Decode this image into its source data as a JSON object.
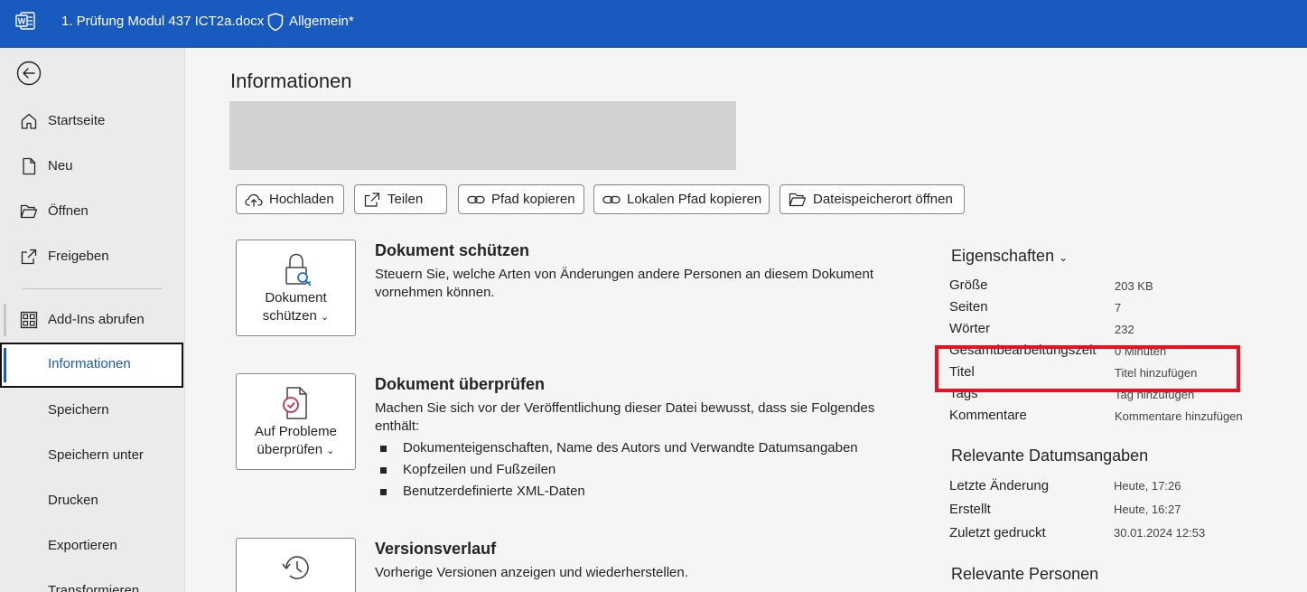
{
  "titlebar": {
    "doc_title": "1. Prüfung Modul 437 ICT2a.docx",
    "sensitivity": "Allgemein*",
    "accent": "#185abd"
  },
  "sidebar": {
    "items": [
      {
        "label": "Startseite",
        "icon": "home-icon"
      },
      {
        "label": "Neu",
        "icon": "new-document-icon"
      },
      {
        "label": "Öffnen",
        "icon": "folder-open-icon"
      },
      {
        "label": "Freigeben",
        "icon": "share-icon"
      },
      {
        "label": "Add-Ins abrufen",
        "icon": "apps-grid-icon"
      },
      {
        "label": "Informationen",
        "active": true
      },
      {
        "label": "Speichern"
      },
      {
        "label": "Speichern unter"
      },
      {
        "label": "Drucken"
      },
      {
        "label": "Exportieren"
      },
      {
        "label": "Transformieren"
      }
    ]
  },
  "main": {
    "heading": "Informationen",
    "actions": [
      {
        "label": "Hochladen",
        "icon": "upload-cloud-icon"
      },
      {
        "label": "Teilen",
        "icon": "share-icon"
      },
      {
        "label": "Pfad kopieren",
        "icon": "link-icon"
      },
      {
        "label": "Lokalen Pfad kopieren",
        "icon": "link-icon"
      },
      {
        "label": "Dateispeicherort öffnen",
        "icon": "folder-icon"
      }
    ],
    "protect": {
      "button_line1": "Dokument",
      "button_line2": "schützen",
      "title": "Dokument schützen",
      "text": "Steuern Sie, welche Arten von Änderungen andere Personen an diesem Dokument vornehmen können."
    },
    "inspect": {
      "button_line1": "Auf Probleme",
      "button_line2": "überprüfen",
      "title": "Dokument überprüfen",
      "text": "Machen Sie sich vor der Veröffentlichung dieser Datei bewusst, dass sie Folgendes enthält:",
      "bullets": [
        "Dokumenteigenschaften, Name des Autors und Verwandte Datumsangaben",
        "Kopfzeilen und Fußzeilen",
        "Benutzerdefinierte XML-Daten"
      ]
    },
    "versions": {
      "title": "Versionsverlauf",
      "text": "Vorherige Versionen anzeigen und wiederherstellen."
    }
  },
  "properties": {
    "heading": "Eigenschaften",
    "rows": [
      {
        "label": "Größe",
        "value": "203 KB"
      },
      {
        "label": "Seiten",
        "value": "7"
      },
      {
        "label": "Wörter",
        "value": "232"
      },
      {
        "label": "Gesamtbearbeitungszeit",
        "value": "0 Minuten"
      },
      {
        "label": "Titel",
        "value": "Titel hinzufügen"
      },
      {
        "label": "Tags",
        "value": "Tag hinzufügen"
      },
      {
        "label": "Kommentare",
        "value": "Kommentare hinzufügen"
      }
    ],
    "dates_heading": "Relevante Datumsangaben",
    "dates": [
      {
        "label": "Letzte Änderung",
        "value": "Heute, 17:26"
      },
      {
        "label": "Erstellt",
        "value": "Heute, 16:27"
      },
      {
        "label": "Zuletzt gedruckt",
        "value": "30.01.2024 12:53"
      }
    ],
    "people_heading": "Relevante Personen",
    "highlight_color": "#e81123"
  }
}
